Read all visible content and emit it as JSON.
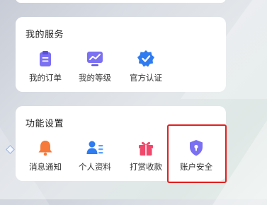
{
  "services": {
    "title": "我的服务",
    "items": [
      {
        "label": "我的订单",
        "icon": "clipboard-icon",
        "color": "#7b6ff2"
      },
      {
        "label": "我的等级",
        "icon": "chart-level-icon",
        "color": "#7b6ff2"
      },
      {
        "label": "官方认证",
        "icon": "verified-badge-icon",
        "color": "#2f7bf0"
      }
    ]
  },
  "settings": {
    "title": "功能设置",
    "items": [
      {
        "label": "消息通知",
        "icon": "bell-icon",
        "color": "#f57a3b"
      },
      {
        "label": "个人资料",
        "icon": "profile-icon",
        "color": "#2f7bf0"
      },
      {
        "label": "打赏收款",
        "icon": "gift-icon",
        "color": "#f0476a"
      },
      {
        "label": "账户安全",
        "icon": "shield-lock-icon",
        "color": "#7b6ff2"
      }
    ]
  },
  "highlight_color": "#e02020"
}
